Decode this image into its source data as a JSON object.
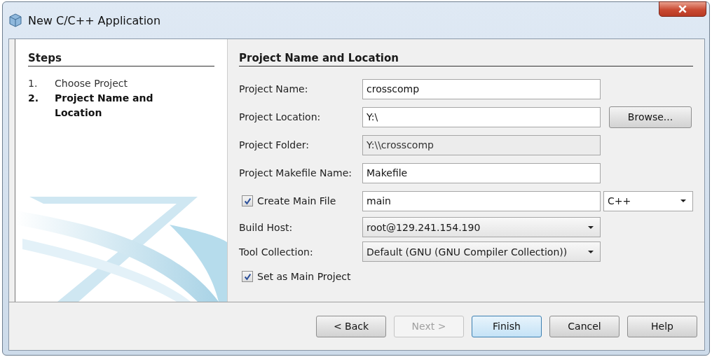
{
  "window": {
    "title": "New C/C++ Application"
  },
  "steps": {
    "title": "Steps",
    "items": [
      {
        "number": "1.",
        "label": "Choose Project",
        "selected": false
      },
      {
        "number": "2.",
        "label": "Project Name and Location",
        "selected": true
      }
    ]
  },
  "panel": {
    "title": "Project Name and Location",
    "rows": [
      {
        "kind": "text",
        "label": "Project Name:",
        "value": "crosscomp"
      },
      {
        "kind": "text",
        "label": "Project Location:",
        "value": "Y:\\",
        "button": "Browse..."
      },
      {
        "kind": "readonly",
        "label": "Project Folder:",
        "value": "Y:\\\\crosscomp"
      },
      {
        "kind": "text",
        "label": "Project Makefile Name:",
        "value": "Makefile"
      },
      {
        "kind": "check",
        "label": "Create Main File",
        "checked": true,
        "value": "main",
        "combo": "C++"
      },
      {
        "kind": "combo",
        "label": "Build Host:",
        "value": "root@129.241.154.190"
      },
      {
        "kind": "combo",
        "label": "Tool Collection:",
        "value": "Default (GNU (GNU Compiler Collection))"
      },
      {
        "kind": "check",
        "label": "Set as Main Project",
        "checked": true
      }
    ]
  },
  "buttons": [
    {
      "label": "< Back",
      "disabled": false,
      "default": false
    },
    {
      "label": "Next >",
      "disabled": true,
      "default": false
    },
    {
      "label": "Finish",
      "disabled": false,
      "default": true
    },
    {
      "label": "Cancel",
      "disabled": false,
      "default": false
    },
    {
      "label": "Help",
      "disabled": false,
      "default": false
    }
  ]
}
